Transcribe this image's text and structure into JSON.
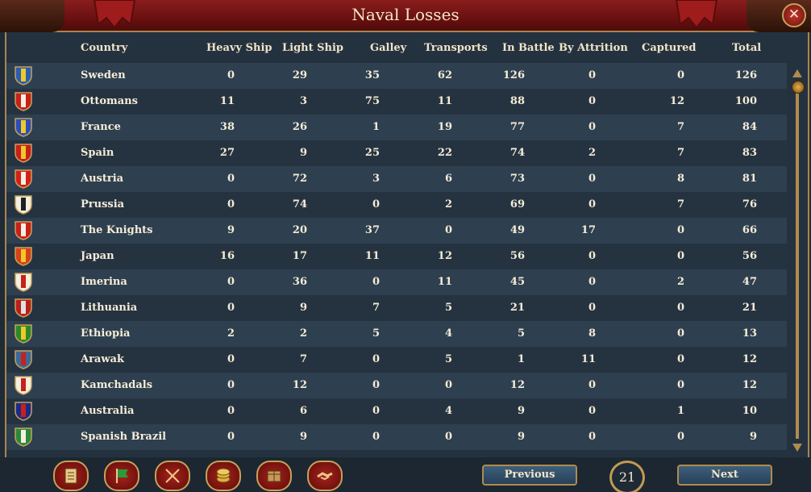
{
  "window": {
    "title": "Naval Losses"
  },
  "columns": [
    {
      "key": "country",
      "label": "Country"
    },
    {
      "key": "heavy",
      "label": "Heavy Ship"
    },
    {
      "key": "light",
      "label": "Light Ship"
    },
    {
      "key": "galley",
      "label": "Galley"
    },
    {
      "key": "transports",
      "label": "Transports"
    },
    {
      "key": "battle",
      "label": "In Battle"
    },
    {
      "key": "attrition",
      "label": "By Attrition"
    },
    {
      "key": "captured",
      "label": "Captured"
    },
    {
      "key": "total",
      "label": "Total"
    }
  ],
  "rows": [
    {
      "country": "Sweden",
      "heavy": "0",
      "light": "29",
      "galley": "35",
      "transports": "62",
      "battle": "126",
      "attrition": "0",
      "captured": "0",
      "total": "126",
      "flag": [
        "#2a5fb0",
        "#f0c828"
      ]
    },
    {
      "country": "Ottomans",
      "heavy": "11",
      "light": "3",
      "galley": "75",
      "transports": "11",
      "battle": "88",
      "attrition": "0",
      "captured": "12",
      "total": "100",
      "flag": [
        "#c8201a",
        "#f4f0e0"
      ]
    },
    {
      "country": "France",
      "heavy": "38",
      "light": "26",
      "galley": "1",
      "transports": "19",
      "battle": "77",
      "attrition": "0",
      "captured": "7",
      "total": "84",
      "flag": [
        "#2a4fb8",
        "#f0c828"
      ]
    },
    {
      "country": "Spain",
      "heavy": "27",
      "light": "9",
      "galley": "25",
      "transports": "22",
      "battle": "74",
      "attrition": "2",
      "captured": "7",
      "total": "83",
      "flag": [
        "#c8201a",
        "#f0c828"
      ]
    },
    {
      "country": "Austria",
      "heavy": "0",
      "light": "72",
      "galley": "3",
      "transports": "6",
      "battle": "73",
      "attrition": "0",
      "captured": "8",
      "total": "81",
      "flag": [
        "#d4201a",
        "#f4f0e0"
      ]
    },
    {
      "country": "Prussia",
      "heavy": "0",
      "light": "74",
      "galley": "0",
      "transports": "2",
      "battle": "69",
      "attrition": "0",
      "captured": "7",
      "total": "76",
      "flag": [
        "#f4f0e0",
        "#202020"
      ]
    },
    {
      "country": "The Knights",
      "heavy": "9",
      "light": "20",
      "galley": "37",
      "transports": "0",
      "battle": "49",
      "attrition": "17",
      "captured": "0",
      "total": "66",
      "flag": [
        "#c8201a",
        "#f4f0e0"
      ]
    },
    {
      "country": "Japan",
      "heavy": "16",
      "light": "17",
      "galley": "11",
      "transports": "12",
      "battle": "56",
      "attrition": "0",
      "captured": "0",
      "total": "56",
      "flag": [
        "#d8401a",
        "#f0c828"
      ]
    },
    {
      "country": "Imerina",
      "heavy": "0",
      "light": "36",
      "galley": "0",
      "transports": "11",
      "battle": "45",
      "attrition": "0",
      "captured": "2",
      "total": "47",
      "flag": [
        "#f4f0e0",
        "#c8201a"
      ]
    },
    {
      "country": "Lithuania",
      "heavy": "0",
      "light": "9",
      "galley": "7",
      "transports": "5",
      "battle": "21",
      "attrition": "0",
      "captured": "0",
      "total": "21",
      "flag": [
        "#b8201a",
        "#e0e0e0"
      ]
    },
    {
      "country": "Ethiopia",
      "heavy": "2",
      "light": "2",
      "galley": "5",
      "transports": "4",
      "battle": "5",
      "attrition": "8",
      "captured": "0",
      "total": "13",
      "flag": [
        "#2a8a2a",
        "#f0c828"
      ]
    },
    {
      "country": "Arawak",
      "heavy": "0",
      "light": "7",
      "galley": "0",
      "transports": "5",
      "battle": "1",
      "attrition": "11",
      "captured": "0",
      "total": "12",
      "flag": [
        "#3a6a9a",
        "#c8201a"
      ]
    },
    {
      "country": "Kamchadals",
      "heavy": "0",
      "light": "12",
      "galley": "0",
      "transports": "0",
      "battle": "12",
      "attrition": "0",
      "captured": "0",
      "total": "12",
      "flag": [
        "#f4f0e0",
        "#c8201a"
      ]
    },
    {
      "country": "Australia",
      "heavy": "0",
      "light": "6",
      "galley": "0",
      "transports": "4",
      "battle": "9",
      "attrition": "0",
      "captured": "1",
      "total": "10",
      "flag": [
        "#1a2a8a",
        "#c8201a"
      ]
    },
    {
      "country": "Spanish Brazil",
      "heavy": "0",
      "light": "9",
      "galley": "0",
      "transports": "0",
      "battle": "9",
      "attrition": "0",
      "captured": "0",
      "total": "9",
      "flag": [
        "#2a8a3a",
        "#f4f0e0"
      ]
    }
  ],
  "pagination": {
    "previous_label": "Previous",
    "next_label": "Next",
    "page": "21"
  },
  "toolbar": [
    "ledger-icon",
    "flag-icon",
    "crossed-swords-icon",
    "coins-icon",
    "crate-icon",
    "handshake-icon"
  ],
  "colors": {
    "accent_gold": "#b08b4c",
    "title_red": "#7a1414"
  }
}
